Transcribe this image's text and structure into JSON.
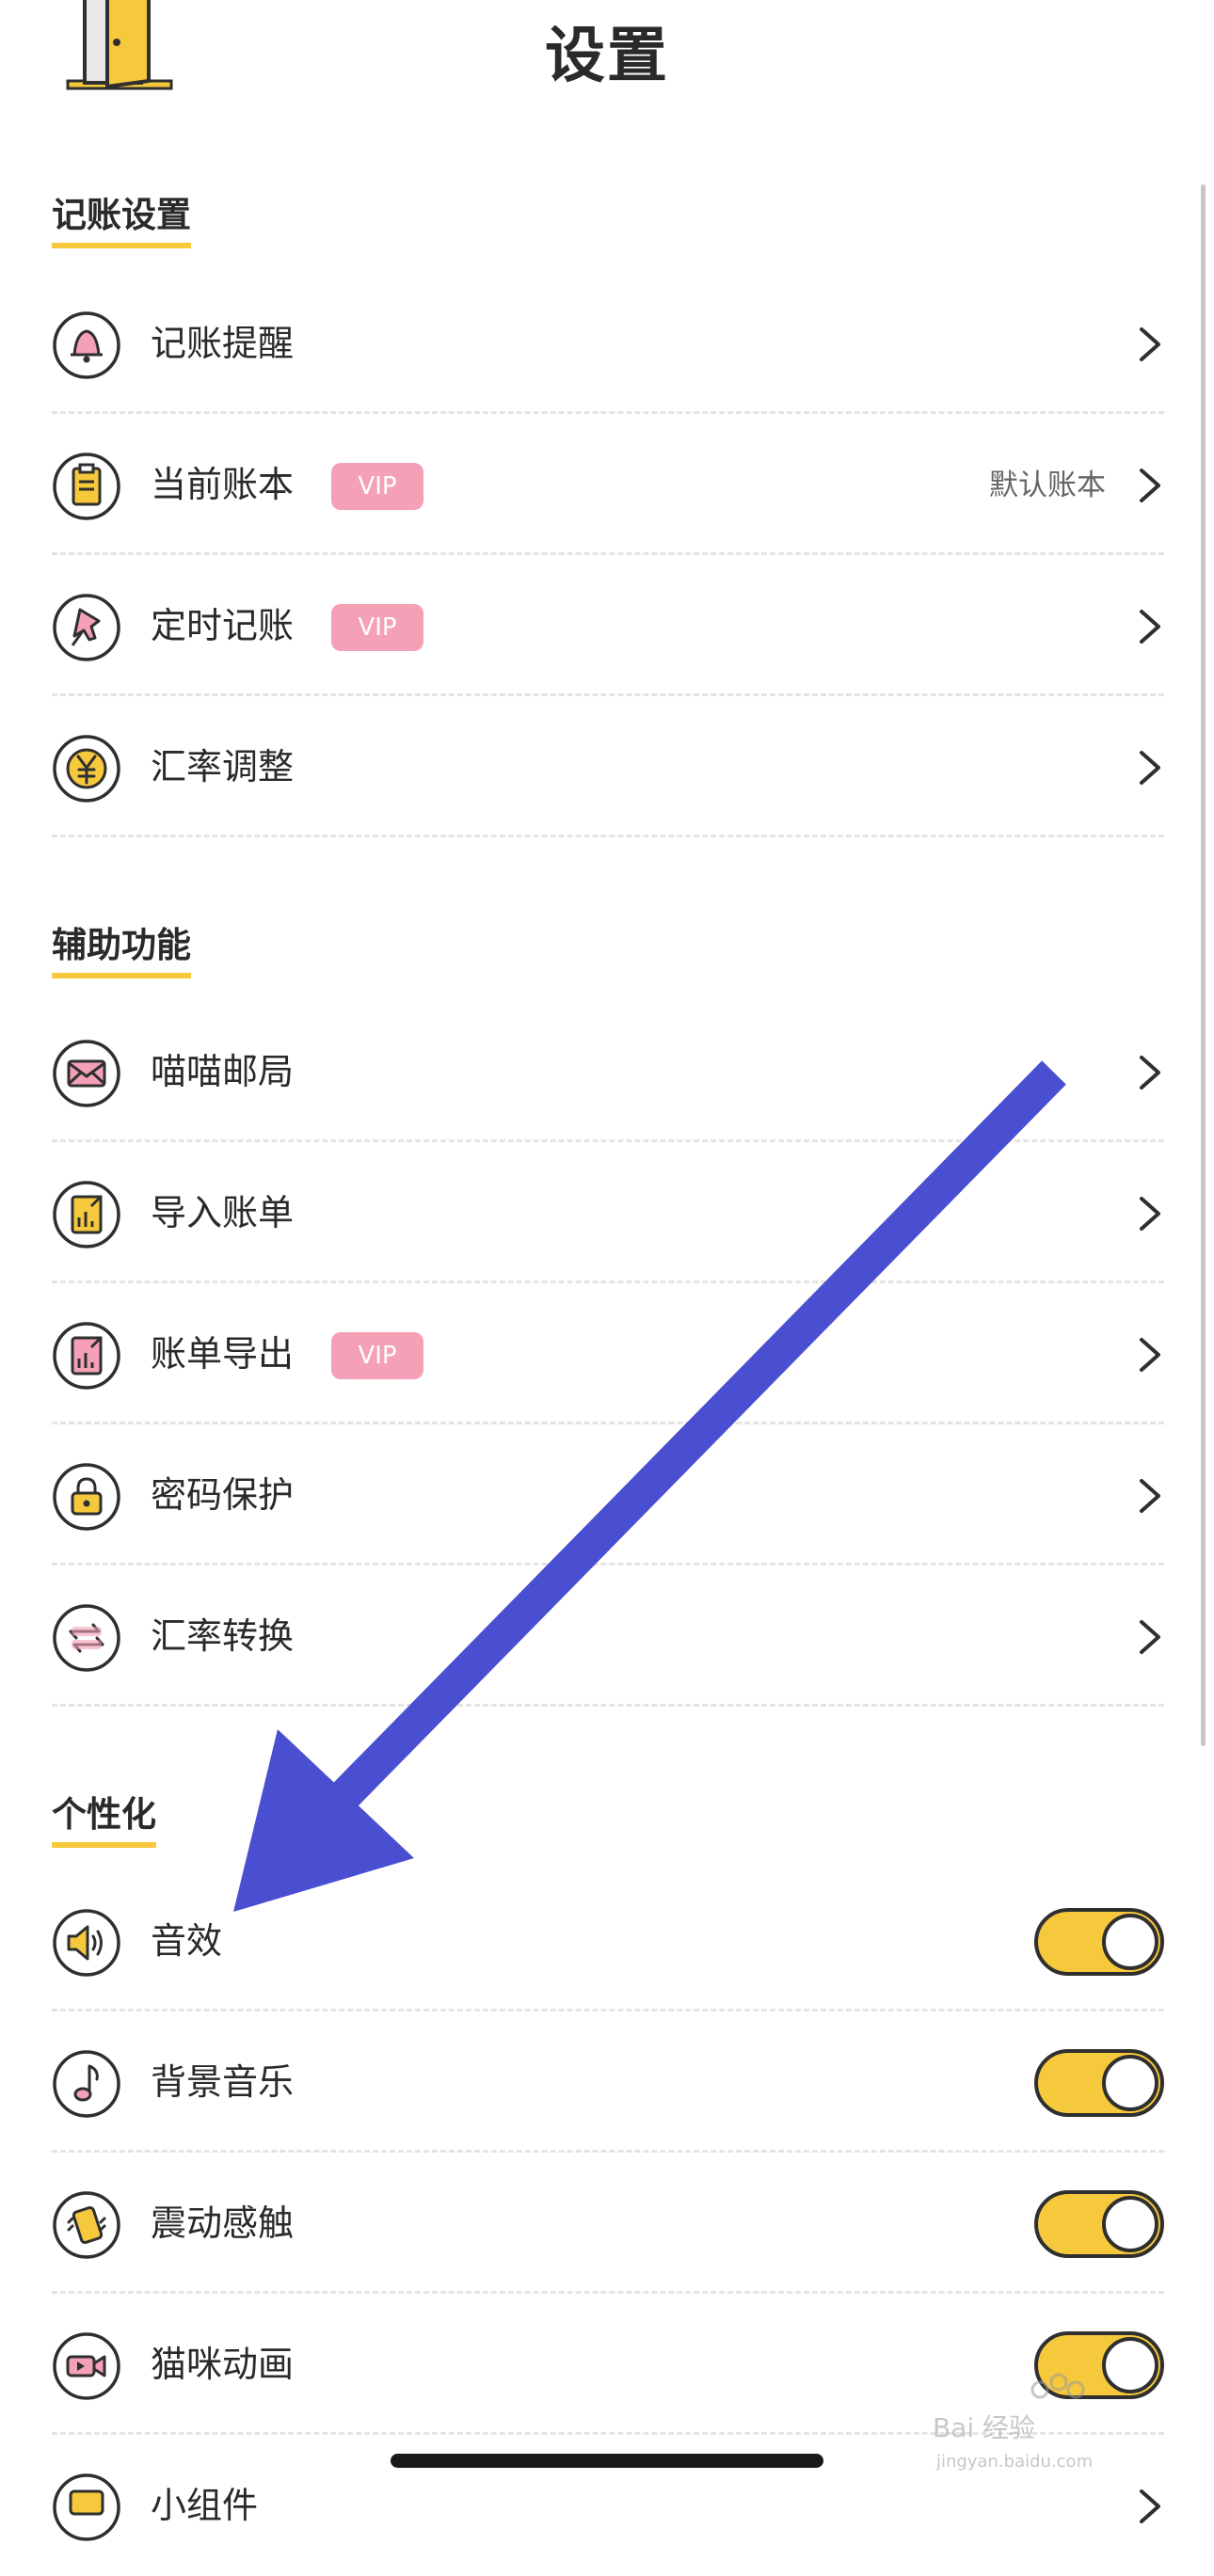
{
  "header": {
    "title": "设置"
  },
  "sections": [
    {
      "title": "记账设置",
      "items": [
        {
          "label": "记账提醒",
          "icon": "bell-icon"
        },
        {
          "label": "当前账本",
          "icon": "ledger-icon",
          "badge": "VIP",
          "value": "默认账本"
        },
        {
          "label": "定时记账",
          "icon": "pin-icon",
          "badge": "VIP"
        },
        {
          "label": "汇率调整",
          "icon": "yen-icon"
        }
      ]
    },
    {
      "title": "辅助功能",
      "items": [
        {
          "label": "喵喵邮局",
          "icon": "mail-icon"
        },
        {
          "label": "导入账单",
          "icon": "import-icon"
        },
        {
          "label": "账单导出",
          "icon": "export-icon",
          "badge": "VIP"
        },
        {
          "label": "密码保护",
          "icon": "lock-icon"
        },
        {
          "label": "汇率转换",
          "icon": "exchange-icon"
        }
      ]
    },
    {
      "title": "个性化",
      "items": [
        {
          "label": "音效",
          "icon": "speaker-icon",
          "toggle": true
        },
        {
          "label": "背景音乐",
          "icon": "music-note-icon",
          "toggle": true
        },
        {
          "label": "震动感触",
          "icon": "vibration-icon",
          "toggle": true
        },
        {
          "label": "猫咪动画",
          "icon": "video-icon",
          "toggle": true
        },
        {
          "label": "小组件",
          "icon": "widget-icon"
        }
      ]
    }
  ],
  "colors": {
    "accent": "#f6c83c",
    "vip": "#f4a0b6",
    "annotation_arrow": "#4a4fd1"
  },
  "watermark": {
    "text": "Bai 经验",
    "url": "jingyan.baidu.com"
  }
}
